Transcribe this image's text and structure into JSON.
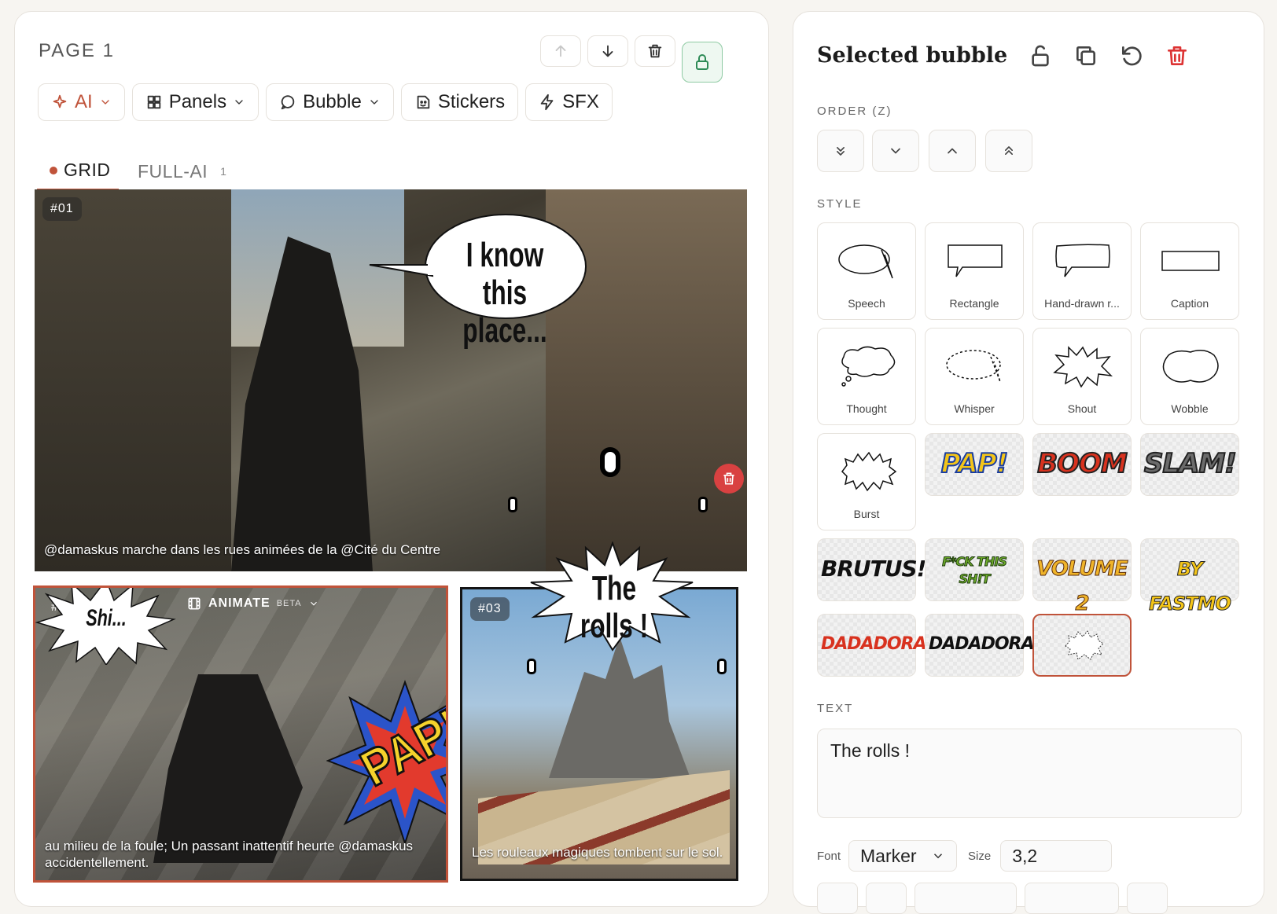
{
  "page": {
    "title": "PAGE 1"
  },
  "toolbar": {
    "ai": "AI",
    "panels": "Panels",
    "bubble": "Bubble",
    "stickers": "Stickers",
    "sfx": "SFX"
  },
  "tabs": {
    "grid": "GRID",
    "full_ai": "FULL-AI",
    "full_ai_count": "1"
  },
  "panels": [
    {
      "tag": "#01",
      "caption": "@damaskus marche dans les rues animées de la @Cité du Centre",
      "bubble": "I know this place..."
    },
    {
      "tag": "#02",
      "caption": "au milieu de la foule; Un passant inattentif heurte @damaskus accidentellement.",
      "bubble": "Shi...",
      "sfx": "PAP!",
      "animate": "ANIMATE",
      "beta": "BETA"
    },
    {
      "tag": "#03",
      "caption": "Les rouleaux magiques tombent sur le sol.",
      "bubble": "The rolls !"
    }
  ],
  "inspector": {
    "title": "Selected bubble",
    "order_label": "ORDER (Z)",
    "style_label": "STYLE",
    "styles": [
      "Speech",
      "Rectangle",
      "Hand-drawn r...",
      "Caption",
      "Thought",
      "Whisper",
      "Shout",
      "Wobble",
      "Burst"
    ],
    "stickers": [
      "PAP!",
      "BOOM",
      "SLAM!",
      "BRUTUS!",
      "F*CK THIS SH!T",
      "VOLUME 2",
      "BY FASTMO",
      "DADADORA!!!",
      "DADADORA!!!"
    ],
    "text_label": "TEXT",
    "text_value": "The rolls !",
    "font_label": "Font",
    "font_value": "Marker",
    "size_label": "Size",
    "size_value": "3,2"
  },
  "colors": {
    "accent": "#c0533a",
    "danger": "#d33333",
    "lock_green": "#2e8b57"
  }
}
